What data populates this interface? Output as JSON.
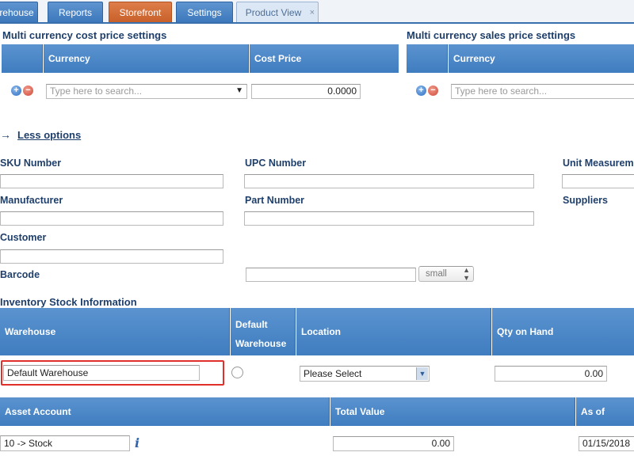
{
  "tabs": [
    {
      "label": "rehouse"
    },
    {
      "label": "Reports"
    },
    {
      "label": "Storefront"
    },
    {
      "label": "Settings"
    },
    {
      "label": "Product View",
      "close": "×"
    }
  ],
  "cost_settings": {
    "title": "Multi currency cost price settings",
    "col_currency": "Currency",
    "col_cost": "Cost Price",
    "currency_placeholder": "Type here to search...",
    "dropdown_arrow": "▼",
    "cost_value": "0.0000"
  },
  "sales_settings": {
    "title": "Multi currency sales price settings",
    "col_currency": "Currency",
    "currency_placeholder": "Type here to search..."
  },
  "options": {
    "arrow": "→",
    "less_options": "Less options"
  },
  "fields": {
    "sku": "SKU Number",
    "upc": "UPC Number",
    "unit": "Unit Measurem",
    "manufacturer": "Manufacturer",
    "part": "Part Number",
    "suppliers": "Suppliers",
    "customer": "Customer",
    "barcode": "Barcode",
    "barcode_size": "small"
  },
  "inventory": {
    "title": "Inventory Stock Information",
    "col_warehouse": "Warehouse",
    "col_default_1": "Default",
    "col_default_2": "Warehouse",
    "col_location": "Location",
    "col_qty": "Qty on Hand",
    "warehouse_value": "Default Warehouse",
    "location_value": "Please Select",
    "qty_value": "0.00"
  },
  "asset": {
    "col_account": "Asset Account",
    "col_total": "Total Value",
    "col_asof": "As of",
    "account_value": "10 -> Stock",
    "info_icon": "i",
    "total_value": "0.00",
    "date_value": "01/15/2018"
  },
  "colors": {
    "header_blue": "#4a86c6",
    "tab_orange": "#cf6a33",
    "highlight_red": "#e0302b"
  }
}
